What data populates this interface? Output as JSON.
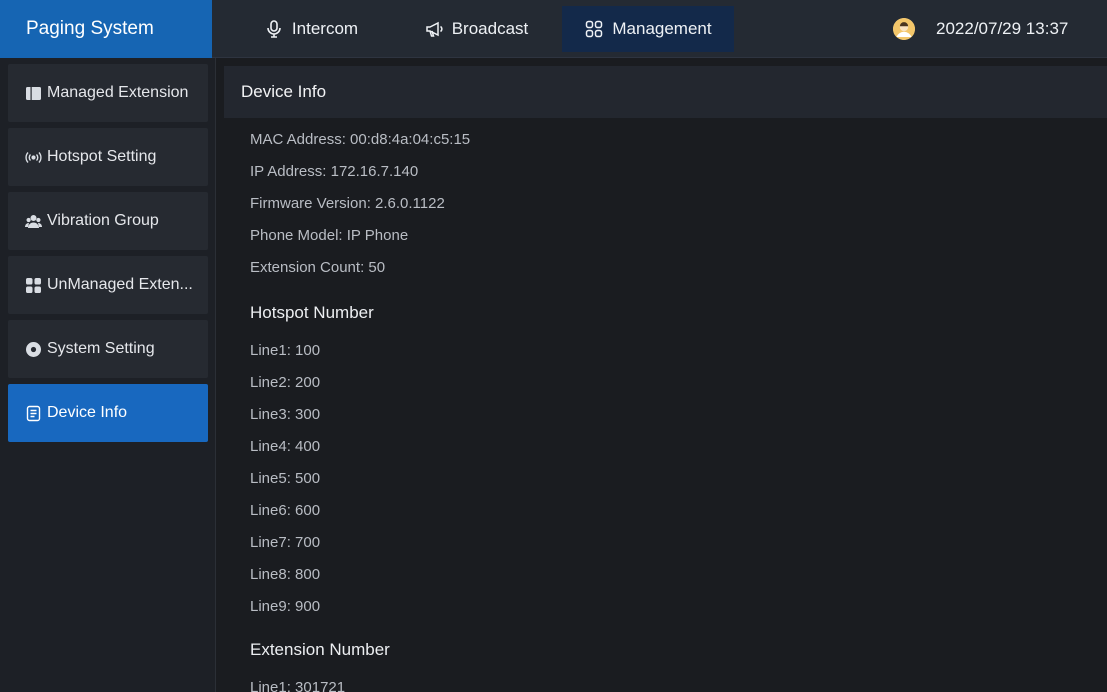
{
  "app": {
    "title": "Paging System"
  },
  "header": {
    "tabs": [
      {
        "label": "Intercom",
        "icon": "microphone-icon"
      },
      {
        "label": "Broadcast",
        "icon": "megaphone-icon"
      },
      {
        "label": "Management",
        "icon": "grid-icon",
        "active": true
      }
    ],
    "datetime": "2022/07/29 13:37"
  },
  "sidebar": {
    "items": [
      {
        "label": "Managed Extension",
        "icon": "book-icon"
      },
      {
        "label": "Hotspot Setting",
        "icon": "hotspot-icon"
      },
      {
        "label": "Vibration Group",
        "icon": "group-icon"
      },
      {
        "label": "UnManaged Exten...",
        "icon": "apps-icon"
      },
      {
        "label": "System Setting",
        "icon": "gear-icon"
      },
      {
        "label": "Device Info",
        "icon": "document-icon",
        "active": true
      }
    ]
  },
  "content": {
    "title": "Device Info",
    "info": [
      "MAC Address: 00:d8:4a:04:c5:15",
      "IP Address: 172.16.7.140",
      "Firmware Version: 2.6.0.1122",
      "Phone Model: IP Phone",
      "Extension Count: 50"
    ],
    "hotspot": {
      "title": "Hotspot Number",
      "lines": [
        "Line1: 100",
        "Line2: 200",
        "Line3: 300",
        "Line4: 400",
        "Line5: 500",
        "Line6: 600",
        "Line7: 700",
        "Line8: 800",
        "Line9: 900"
      ]
    },
    "extension": {
      "title": "Extension Number",
      "lines": [
        "Line1: 301721"
      ]
    }
  },
  "colors": {
    "accent": "#1665b3",
    "active_tab": "#13294a",
    "background": "#1a1c20"
  }
}
